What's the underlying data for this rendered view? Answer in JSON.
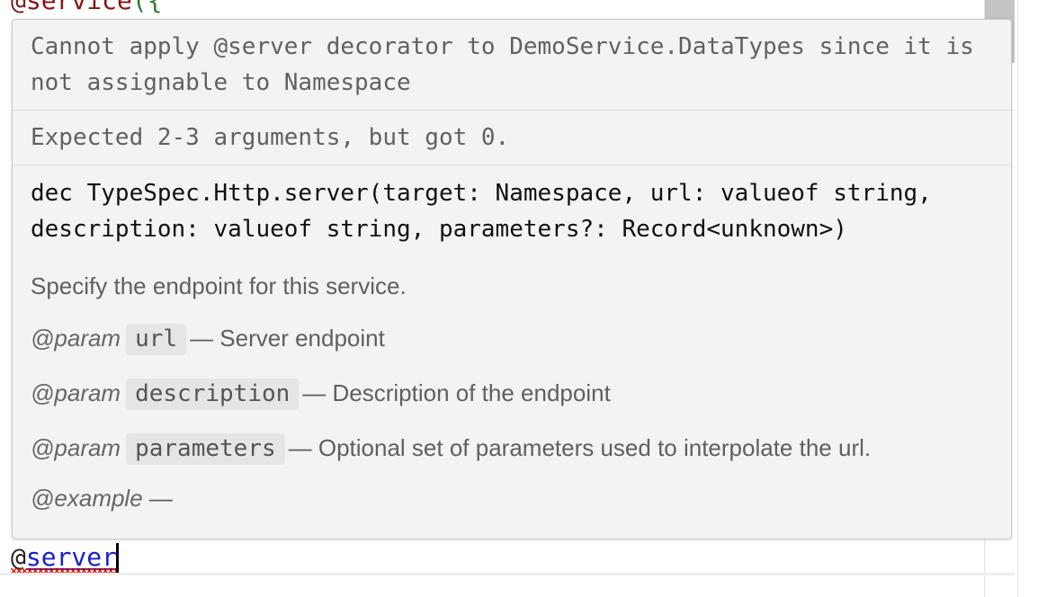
{
  "editor": {
    "top_line": {
      "at": "@",
      "keyword": "service",
      "paren": "({"
    },
    "bottom_line": {
      "at": "@",
      "decorator": "server"
    }
  },
  "hover": {
    "diagnostic_1": "Cannot apply @server decorator to DemoService.DataTypes since it is not assignable to Namespace",
    "diagnostic_2": "Expected 2-3 arguments, but got 0.",
    "signature": "dec TypeSpec.Http.server(target: Namespace, url: valueof string, description: valueof string, parameters?: Record<unknown>)",
    "description": "Specify the endpoint for this service.",
    "params": [
      {
        "tag": "@param",
        "name": "url",
        "text": "— Server endpoint"
      },
      {
        "tag": "@param",
        "name": "description",
        "text": "— Description of the endpoint"
      },
      {
        "tag": "@param",
        "name": "parameters",
        "text": "— Optional set of parameters used to interpolate the url."
      }
    ],
    "example": {
      "tag": "@example",
      "text": "—"
    }
  },
  "colors": {
    "error_squiggle": "#e51400",
    "decorator_link": "#1a20c8",
    "hover_background": "#f3f3f3"
  }
}
